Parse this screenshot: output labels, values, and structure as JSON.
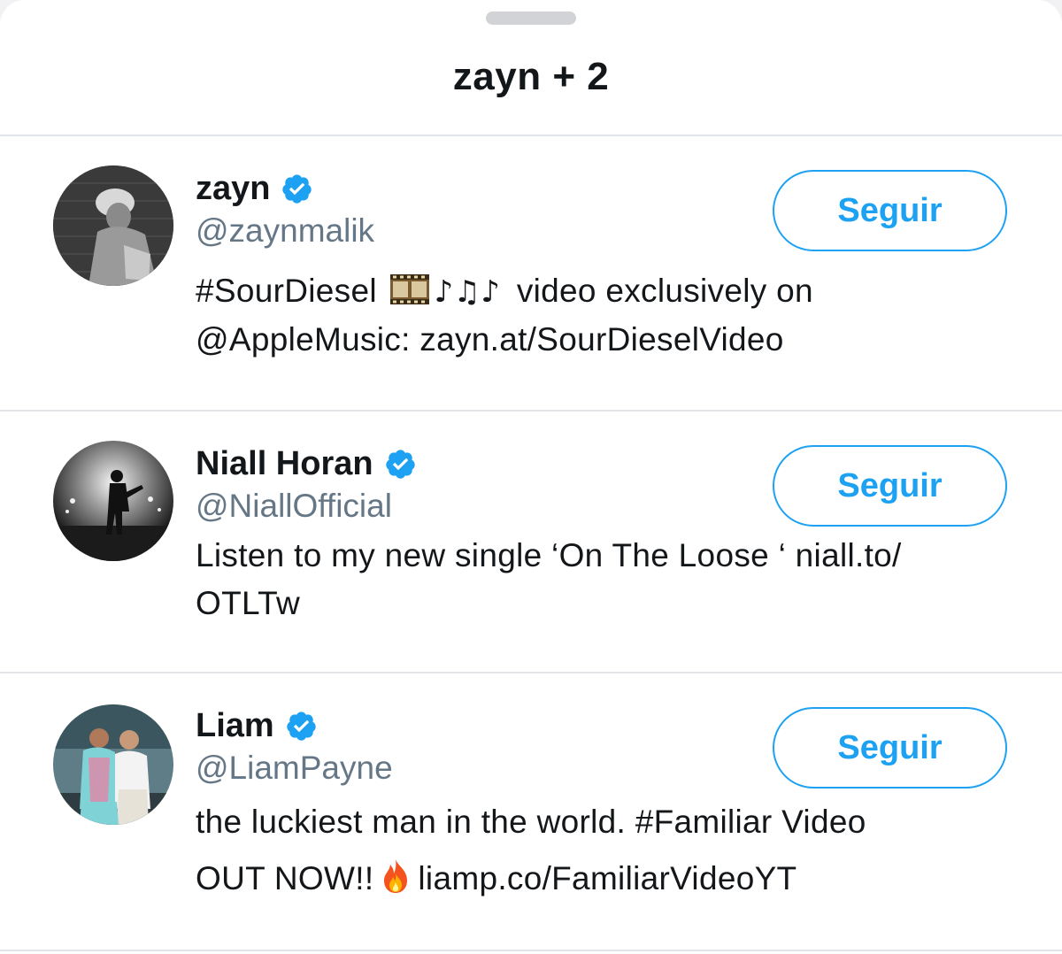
{
  "sheet": {
    "title": "zayn + 2"
  },
  "colors": {
    "accent": "#1da1f2",
    "text_primary": "#14171a",
    "text_secondary": "#657786",
    "divider": "#e1e4e8"
  },
  "users": [
    {
      "name": "zayn",
      "verified": true,
      "handle": "@zaynmalik",
      "bio_line1_a": "#SourDiesel",
      "bio_line1_emoji": [
        "film-frames-icon",
        "musical-notes-icon"
      ],
      "bio_line1_b": "video exclusively on",
      "bio_line2": "@AppleMusic: zayn.at/SourDieselVideo",
      "follow_label": "Seguir"
    },
    {
      "name": "Niall Horan",
      "verified": true,
      "handle": "@NiallOfficial",
      "bio_line1": "Listen to my new single ‘On The Loose ‘ niall.to/",
      "bio_line2": "OTLTw",
      "follow_label": "Seguir"
    },
    {
      "name": "Liam",
      "verified": true,
      "handle": "@LiamPayne",
      "bio_line1": "the luckiest man in the world. #Familiar Video",
      "bio_line2_a": "OUT NOW!!",
      "bio_line2_emoji": "fire-icon",
      "bio_line2_b": "liamp.co/FamiliarVideoYT",
      "follow_label": "Seguir"
    }
  ]
}
